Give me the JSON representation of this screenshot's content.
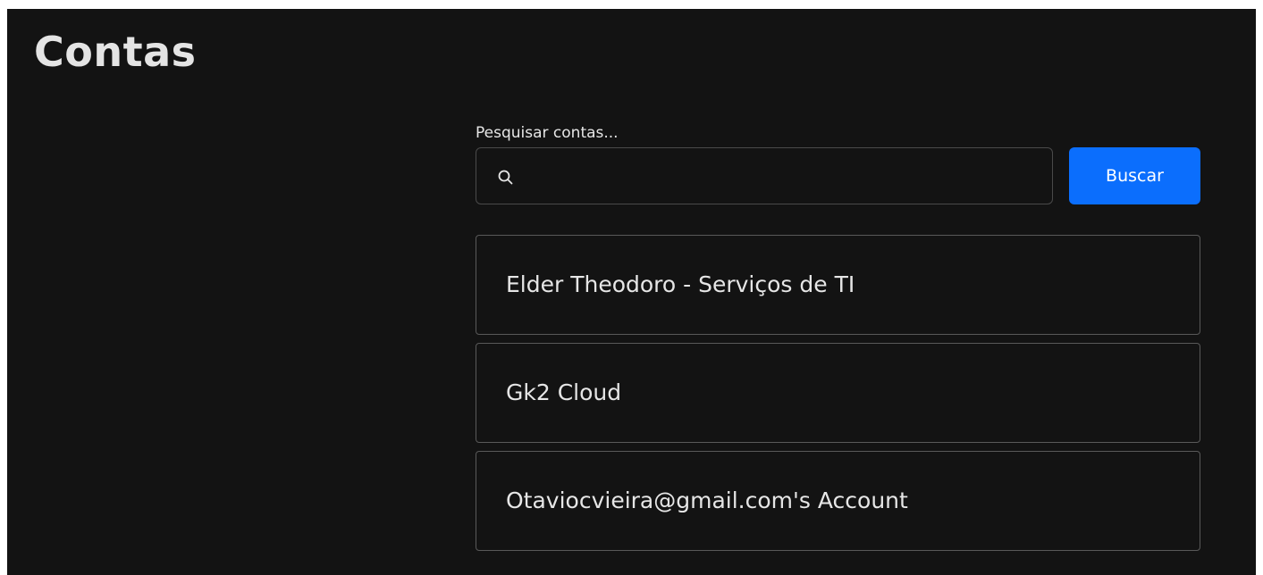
{
  "page": {
    "title": "Contas"
  },
  "search": {
    "label": "Pesquisar contas...",
    "value": "",
    "placeholder": "",
    "button_label": "Buscar",
    "icon": "search-icon"
  },
  "accounts": [
    {
      "name": "Elder Theodoro - Serviços de TI"
    },
    {
      "name": "Gk2 Cloud"
    },
    {
      "name": "Otaviocvieira@gmail.com's Account"
    }
  ],
  "colors": {
    "background": "#131313",
    "text": "#e6e6e6",
    "accent": "#0b6efd",
    "border": "#595959"
  }
}
